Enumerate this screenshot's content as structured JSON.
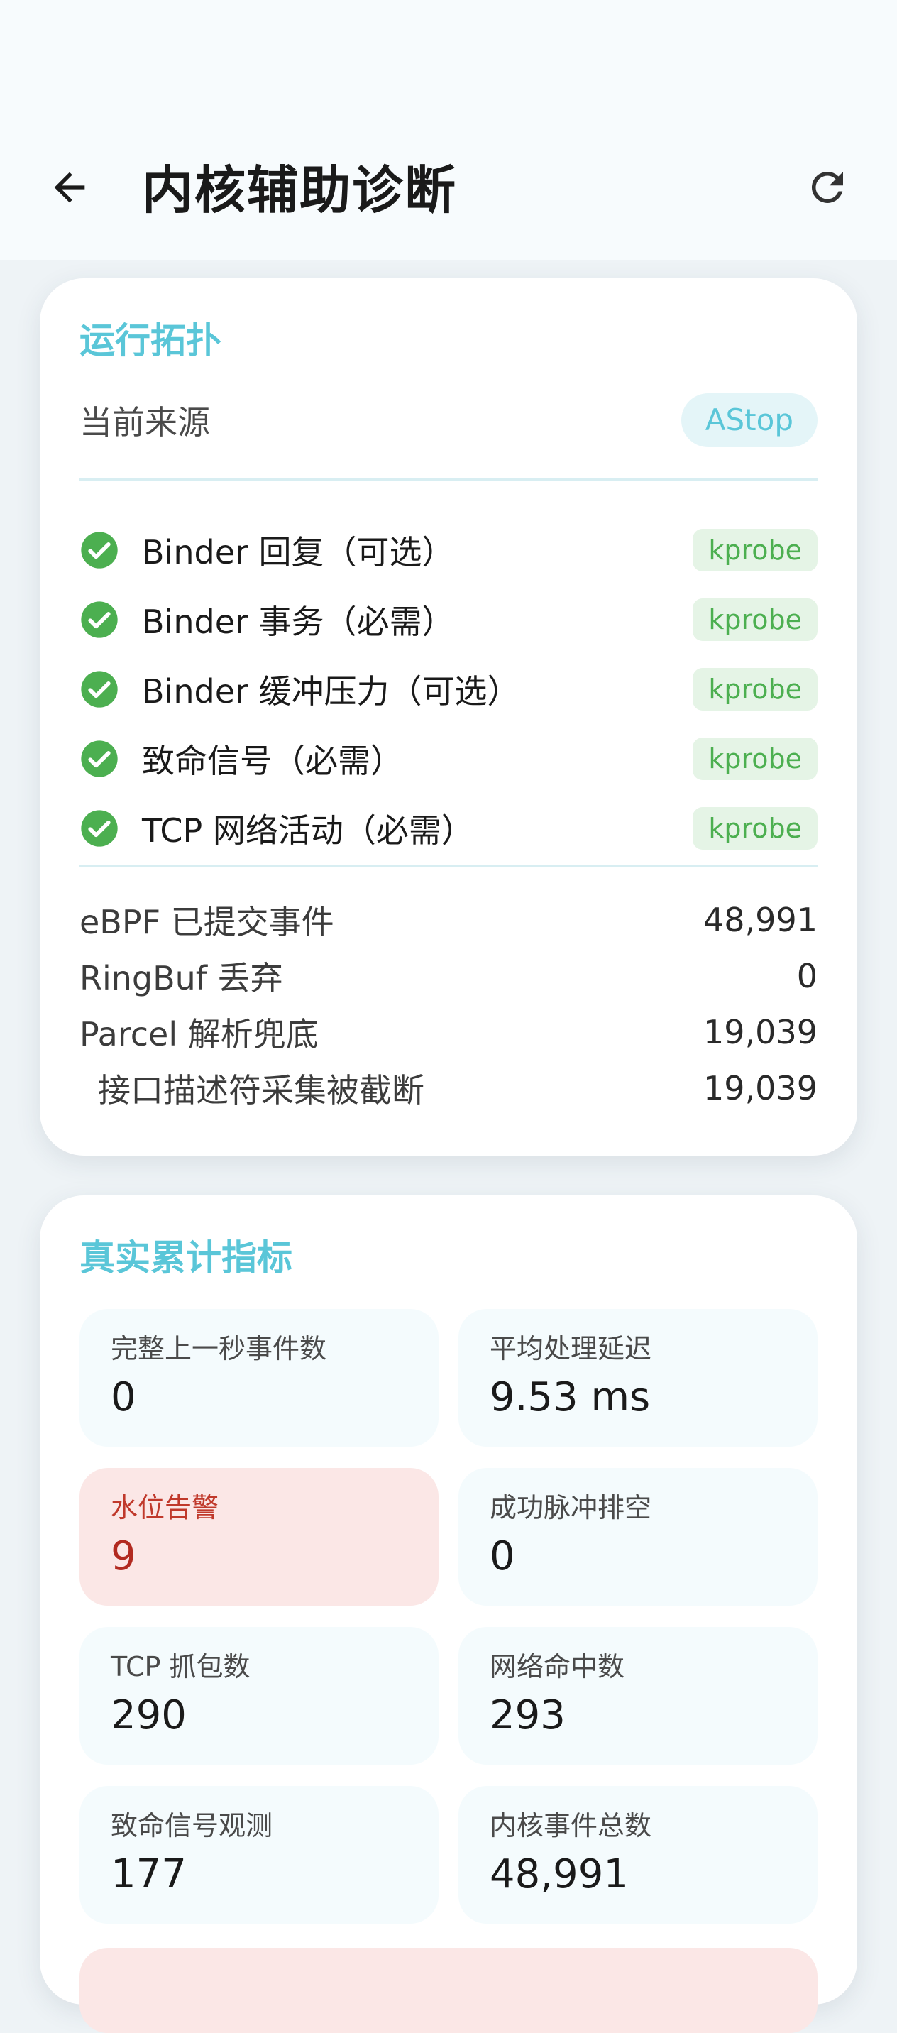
{
  "header": {
    "title": "内核辅助诊断"
  },
  "topology": {
    "title": "运行拓扑",
    "source_label": "当前来源",
    "source_value": "AStop",
    "probes": [
      {
        "label": "Binder 回复（可选）",
        "badge": "kprobe"
      },
      {
        "label": "Binder 事务（必需）",
        "badge": "kprobe"
      },
      {
        "label": "Binder 缓冲压力（可选）",
        "badge": "kprobe"
      },
      {
        "label": "致命信号（必需）",
        "badge": "kprobe"
      },
      {
        "label": "TCP 网络活动（必需）",
        "badge": "kprobe"
      }
    ],
    "stats": [
      {
        "label": "eBPF 已提交事件",
        "value": "48,991"
      },
      {
        "label": "RingBuf 丢弃",
        "value": "0"
      },
      {
        "label": "Parcel 解析兜底",
        "value": "19,039"
      },
      {
        "label": "接口描述符采集被截断",
        "value": "19,039"
      }
    ]
  },
  "metrics": {
    "title": "真实累计指标",
    "tiles": [
      {
        "label": "完整上一秒事件数",
        "value": "0"
      },
      {
        "label": "平均处理延迟",
        "value": "9.53 ms"
      },
      {
        "label": "水位告警",
        "value": "9"
      },
      {
        "label": "成功脉冲排空",
        "value": "0"
      },
      {
        "label": "TCP 抓包数",
        "value": "290"
      },
      {
        "label": "网络命中数",
        "value": "293"
      },
      {
        "label": "致命信号观测",
        "value": "177"
      },
      {
        "label": "内核事件总数",
        "value": "48,991"
      }
    ]
  },
  "colors": {
    "accent": "#5ac6d8",
    "success": "#4caf50",
    "alert": "#b22a20"
  },
  "icons": {
    "back": "arrow-left-icon",
    "refresh": "refresh-icon",
    "probe_ok": "check-circle-icon"
  }
}
